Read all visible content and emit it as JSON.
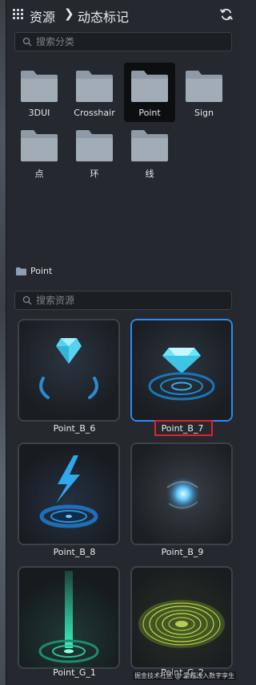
{
  "header": {
    "root_label": "资源",
    "separator": "❯",
    "current_label": "动态标记"
  },
  "search_categories": {
    "placeholder": "搜索分类"
  },
  "folders": [
    {
      "label": "3DUI"
    },
    {
      "label": "Crosshair"
    },
    {
      "label": "Point"
    },
    {
      "label": "Sign"
    },
    {
      "label": "点"
    },
    {
      "label": "环"
    },
    {
      "label": "线"
    }
  ],
  "selected_folder": "Point",
  "section": {
    "title": "Point"
  },
  "search_assets": {
    "placeholder": "搜索资源"
  },
  "assets": [
    {
      "label": "Point_B_6"
    },
    {
      "label": "Point_B_7"
    },
    {
      "label": "Point_B_8"
    },
    {
      "label": "Point_B_9"
    },
    {
      "label": "Point_G_1"
    },
    {
      "label": "Point_G_2"
    }
  ],
  "selected_asset": "Point_B_7",
  "watermark": "掘金技术社区 @ 霊越浅入数字孪生",
  "colors": {
    "panel_bg": "#25292f",
    "accent_blue": "#2a8bf0",
    "highlight_red": "#e1222b",
    "folder_fill": "#8f9aa6"
  }
}
